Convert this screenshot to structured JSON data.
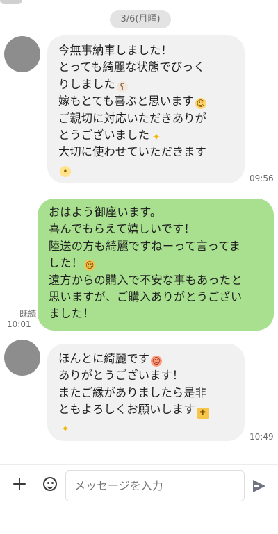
{
  "chat": {
    "date_label": "3/6(月曜)",
    "messages": [
      {
        "side": "incoming",
        "lines": [
          "今無事納車しました！",
          "とっても綺麗な状態でびっく",
          "りしました",
          "嫁もとても喜ぶと思います",
          "ご親切に対応いただきありが",
          "とうございました",
          "大切に使わせていただきます"
        ],
        "time": "09:56"
      },
      {
        "side": "outgoing",
        "lines": [
          "おはよう御座います。",
          "喜んでもらえて嬉しいです！",
          "陸送の方も綺麗ですねーって言ってま",
          "した！",
          "遠方からの購入で不安な事もあったと",
          "思いますが、ご購入ありがとうござい",
          "ました！"
        ],
        "read_label": "既読",
        "time": "10:01"
      },
      {
        "side": "incoming",
        "lines": [
          "ほんとに綺麗です",
          "ありがとうございます！",
          "またご縁がありましたら是非",
          "ともよろしくお願いします"
        ],
        "time": "10:49"
      }
    ]
  },
  "composer": {
    "placeholder": "メッセージを入力"
  },
  "colors": {
    "incoming_bubble": "#f1f1f1",
    "outgoing_bubble": "#a8e08f",
    "date_pill": "#e3e3e3"
  }
}
